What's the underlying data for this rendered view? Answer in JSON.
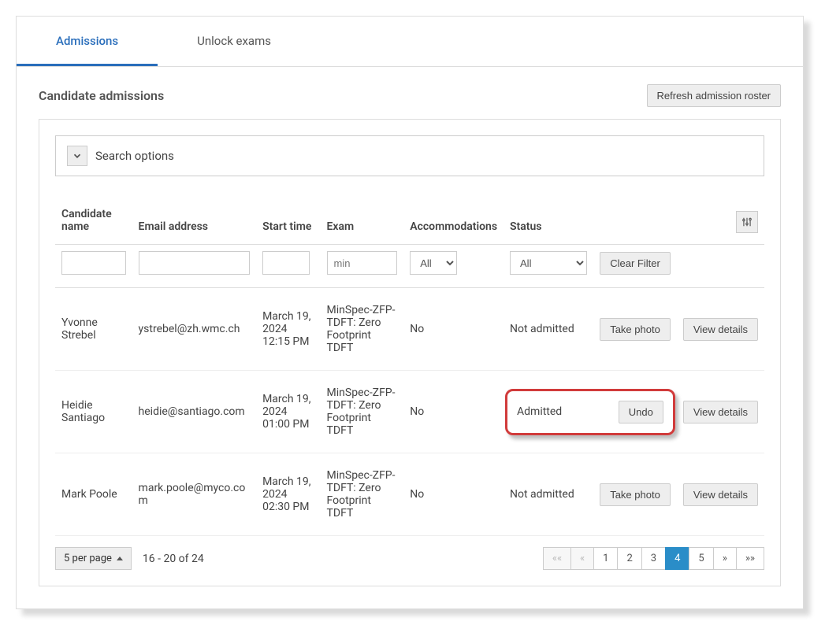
{
  "tabs": {
    "admissions": "Admissions",
    "unlock_exams": "Unlock exams"
  },
  "section": {
    "title": "Candidate admissions",
    "refresh_btn": "Refresh admission roster"
  },
  "search_options": {
    "label": "Search options"
  },
  "headers": {
    "name": "Candidate name",
    "email": "Email address",
    "start": "Start time",
    "exam": "Exam",
    "accom": "Accommodations",
    "status": "Status"
  },
  "filters": {
    "exam_placeholder": "min",
    "accom_value": "All",
    "status_value": "All",
    "clear_btn": "Clear Filter"
  },
  "rows": [
    {
      "name": "Yvonne Strebel",
      "email": "ystrebel@zh.wmc.ch",
      "start": "March 19, 2024 12:15 PM",
      "exam": "MinSpec-ZFP-TDFT: Zero Footprint TDFT",
      "accom": "No",
      "status": "Not admitted",
      "action1_label": "Take photo",
      "action2_label": "View details",
      "highlighted": false
    },
    {
      "name": "Heidie Santiago",
      "email": "heidie@santiago.com",
      "start": "March 19, 2024 01:00 PM",
      "exam": "MinSpec-ZFP-TDFT: Zero Footprint TDFT",
      "accom": "No",
      "status": "Admitted",
      "action1_label": "Undo",
      "action2_label": "View details",
      "highlighted": true
    },
    {
      "name": "Mark Poole",
      "email": "mark.poole@myco.com",
      "start": "March 19, 2024 02:30 PM",
      "exam": "MinSpec-ZFP-TDFT: Zero Footprint TDFT",
      "accom": "No",
      "status": "Not admitted",
      "action1_label": "Take photo",
      "action2_label": "View details",
      "highlighted": false
    }
  ],
  "footer": {
    "per_page_label": "5 per page",
    "range": "16 - 20 of 24",
    "pages": [
      "1",
      "2",
      "3",
      "4",
      "5"
    ],
    "active_page": "4"
  }
}
